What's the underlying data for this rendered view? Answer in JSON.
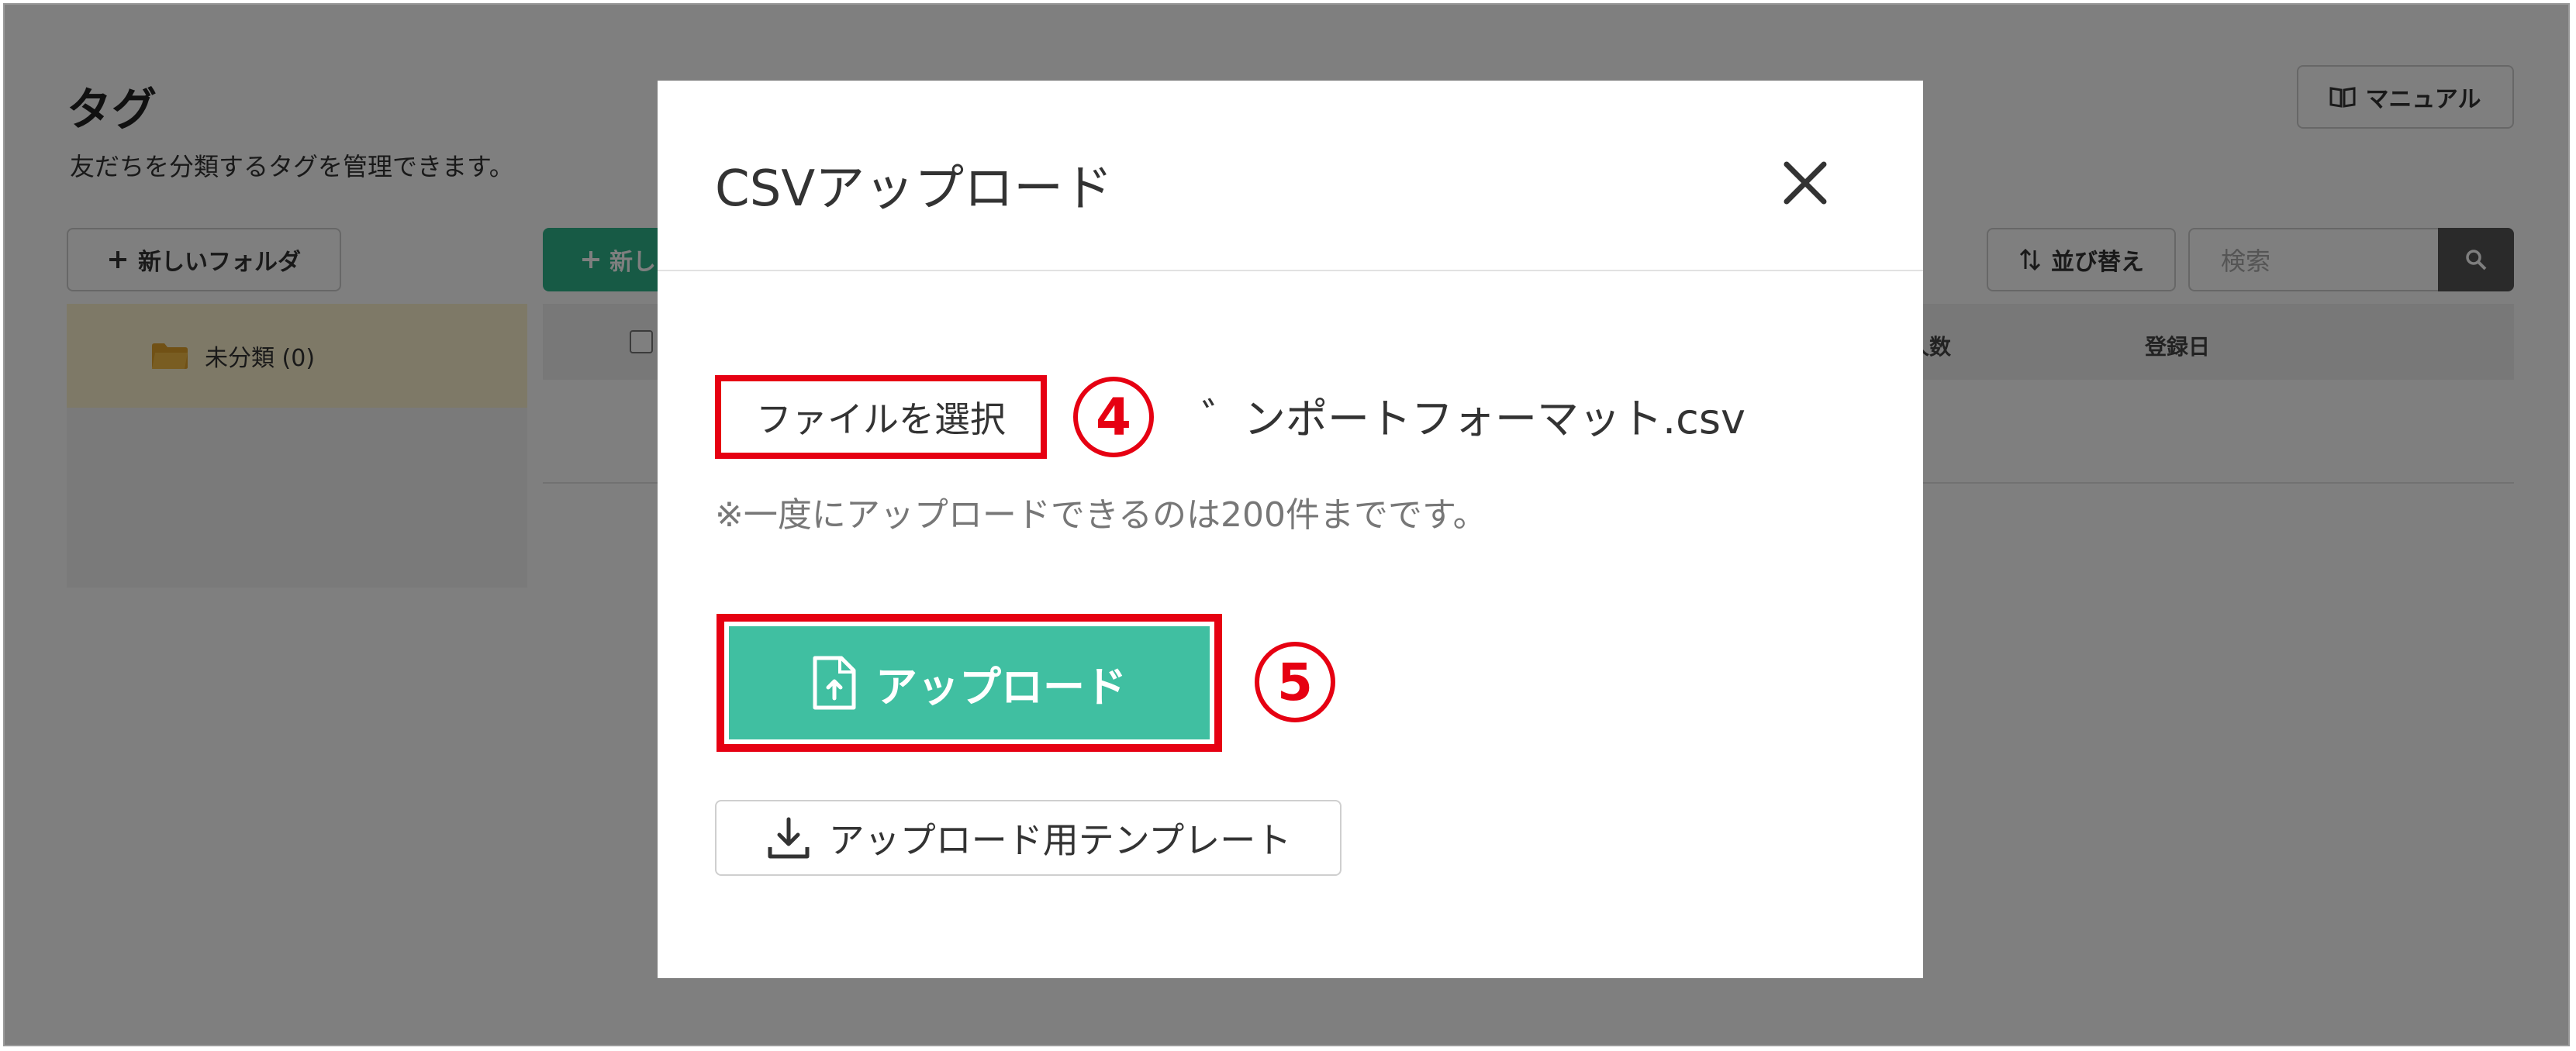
{
  "page": {
    "title": "タグ",
    "description": "友だちを分類するタグを管理できます。",
    "manual_label": "マニュアル",
    "new_folder_label": "新しいフォルダ",
    "new_tag_label": "新し",
    "sort_label": "並び替え",
    "search_placeholder": "検索",
    "folder_item_label": "未分類 (0)",
    "table_headers": {
      "count": "人数",
      "date": "登録日"
    }
  },
  "modal": {
    "title": "CSVアップロード",
    "file_select_label": "ファイルを選択",
    "file_name": "゛ンポートフォーマット.csv",
    "note": "※一度にアップロードできるのは200件までです。",
    "upload_label": "アップロード",
    "template_label": "アップロード用テンプレート"
  },
  "annotations": {
    "callout_4": "4",
    "callout_5": "5"
  },
  "colors": {
    "accent_green": "#40bfa1",
    "highlight_red": "#e60012",
    "folder_bg": "#fdf2cf"
  }
}
